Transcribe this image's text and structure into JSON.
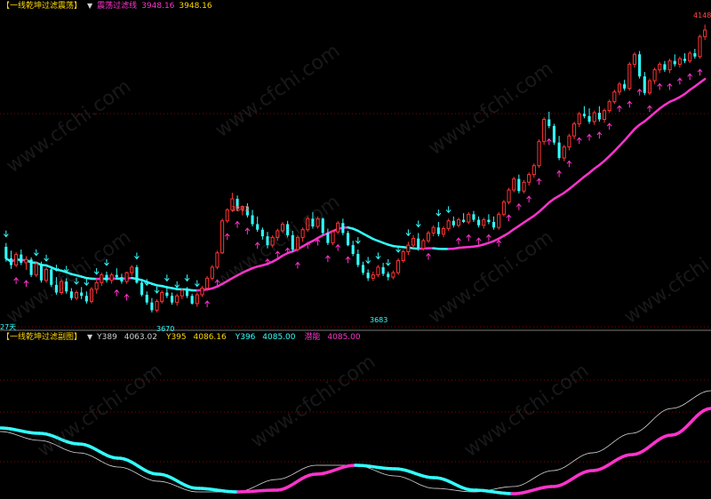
{
  "colors": {
    "background": "#000000",
    "candle_up": "#ff3333",
    "candle_down": "#33ffff",
    "ma_up": "#ff33cc",
    "ma_down": "#33ffff",
    "arrow_up": "#ff33cc",
    "arrow_down": "#33ffff",
    "grid": "#8b0000"
  },
  "main_panel": {
    "indicator_name": "【一线乾坤过滤震荡】",
    "dropdown_icon": "chevron-down-icon",
    "line_label": "震荡过滤线",
    "line_value": "3948.16",
    "extra_value": "3948.16",
    "left_edge_label": "27天",
    "annotations": {
      "high_left": "3843",
      "low_left": "3670",
      "low_mid": "3683",
      "high_right": "4148"
    }
  },
  "sub_panel": {
    "indicator_name": "【一线乾坤过滤副图】",
    "dropdown_icon": "chevron-down-icon",
    "values": [
      {
        "label": "Y389",
        "value": "4063.02"
      },
      {
        "label": "Y395",
        "value": "4086.16"
      },
      {
        "label": "Y396",
        "value": "4085.00"
      },
      {
        "label": "潜能",
        "value": "4085.00"
      }
    ]
  },
  "watermark": "www.cfchi.com",
  "chart_data": {
    "type": "candlestick",
    "ylim": [
      3600,
      4170
    ],
    "candles": [
      [
        3745,
        3752,
        3718,
        3724
      ],
      [
        3724,
        3738,
        3705,
        3712
      ],
      [
        3712,
        3735,
        3708,
        3731
      ],
      [
        3731,
        3740,
        3712,
        3716
      ],
      [
        3716,
        3728,
        3703,
        3722
      ],
      [
        3722,
        3726,
        3690,
        3694
      ],
      [
        3694,
        3718,
        3690,
        3714
      ],
      [
        3714,
        3718,
        3680,
        3684
      ],
      [
        3684,
        3708,
        3680,
        3704
      ],
      [
        3704,
        3708,
        3672,
        3676
      ],
      [
        3676,
        3690,
        3658,
        3662
      ],
      [
        3662,
        3686,
        3658,
        3682
      ],
      [
        3682,
        3688,
        3660,
        3664
      ],
      [
        3664,
        3670,
        3648,
        3652
      ],
      [
        3652,
        3666,
        3648,
        3662
      ],
      [
        3662,
        3672,
        3650,
        3656
      ],
      [
        3656,
        3664,
        3642,
        3646
      ],
      [
        3646,
        3672,
        3642,
        3668
      ],
      [
        3668,
        3684,
        3660,
        3680
      ],
      [
        3680,
        3698,
        3674,
        3694
      ],
      [
        3694,
        3700,
        3680,
        3684
      ],
      [
        3684,
        3698,
        3678,
        3694
      ],
      [
        3694,
        3706,
        3686,
        3690
      ],
      [
        3690,
        3696,
        3678,
        3682
      ],
      [
        3682,
        3700,
        3678,
        3698
      ],
      [
        3698,
        3712,
        3692,
        3708
      ],
      [
        3708,
        3712,
        3678,
        3680
      ],
      [
        3680,
        3684,
        3655,
        3658
      ],
      [
        3658,
        3664,
        3640,
        3644
      ],
      [
        3644,
        3652,
        3626,
        3630
      ],
      [
        3630,
        3650,
        3626,
        3646
      ],
      [
        3646,
        3666,
        3642,
        3662
      ],
      [
        3662,
        3672,
        3652,
        3656
      ],
      [
        3656,
        3662,
        3640,
        3644
      ],
      [
        3644,
        3660,
        3638,
        3656
      ],
      [
        3656,
        3670,
        3650,
        3666
      ],
      [
        3666,
        3672,
        3652,
        3656
      ],
      [
        3656,
        3660,
        3640,
        3642
      ],
      [
        3642,
        3662,
        3636,
        3658
      ],
      [
        3658,
        3674,
        3654,
        3670
      ],
      [
        3670,
        3692,
        3666,
        3688
      ],
      [
        3688,
        3712,
        3684,
        3708
      ],
      [
        3708,
        3738,
        3704,
        3734
      ],
      [
        3734,
        3796,
        3732,
        3792
      ],
      [
        3792,
        3815,
        3788,
        3812
      ],
      [
        3812,
        3843,
        3808,
        3832
      ],
      [
        3832,
        3838,
        3810,
        3814
      ],
      [
        3814,
        3820,
        3802,
        3818
      ],
      [
        3818,
        3824,
        3798,
        3802
      ],
      [
        3802,
        3812,
        3782,
        3786
      ],
      [
        3786,
        3800,
        3772,
        3776
      ],
      [
        3776,
        3780,
        3758,
        3764
      ],
      [
        3764,
        3772,
        3742,
        3748
      ],
      [
        3748,
        3766,
        3744,
        3762
      ],
      [
        3762,
        3778,
        3756,
        3774
      ],
      [
        3774,
        3790,
        3770,
        3786
      ],
      [
        3786,
        3792,
        3762,
        3766
      ],
      [
        3766,
        3774,
        3736,
        3740
      ],
      [
        3740,
        3766,
        3736,
        3762
      ],
      [
        3762,
        3780,
        3754,
        3776
      ],
      [
        3776,
        3800,
        3772,
        3796
      ],
      [
        3796,
        3808,
        3778,
        3782
      ],
      [
        3782,
        3800,
        3778,
        3796
      ],
      [
        3796,
        3798,
        3766,
        3770
      ],
      [
        3770,
        3778,
        3748,
        3752
      ],
      [
        3752,
        3776,
        3748,
        3772
      ],
      [
        3772,
        3792,
        3768,
        3788
      ],
      [
        3788,
        3796,
        3766,
        3770
      ],
      [
        3770,
        3774,
        3746,
        3748
      ],
      [
        3748,
        3756,
        3728,
        3732
      ],
      [
        3732,
        3740,
        3708,
        3712
      ],
      [
        3712,
        3718,
        3694,
        3698
      ],
      [
        3698,
        3704,
        3683,
        3688
      ],
      [
        3688,
        3700,
        3683,
        3694
      ],
      [
        3694,
        3712,
        3690,
        3708
      ],
      [
        3708,
        3716,
        3692,
        3696
      ],
      [
        3696,
        3700,
        3684,
        3690
      ],
      [
        3690,
        3702,
        3686,
        3698
      ],
      [
        3698,
        3724,
        3694,
        3720
      ],
      [
        3720,
        3740,
        3716,
        3736
      ],
      [
        3736,
        3754,
        3730,
        3748
      ],
      [
        3748,
        3766,
        3742,
        3760
      ],
      [
        3760,
        3770,
        3738,
        3742
      ],
      [
        3742,
        3760,
        3738,
        3756
      ],
      [
        3756,
        3774,
        3752,
        3770
      ],
      [
        3770,
        3784,
        3764,
        3780
      ],
      [
        3780,
        3790,
        3764,
        3768
      ],
      [
        3768,
        3782,
        3762,
        3778
      ],
      [
        3778,
        3796,
        3774,
        3792
      ],
      [
        3792,
        3800,
        3780,
        3784
      ],
      [
        3784,
        3798,
        3780,
        3794
      ],
      [
        3794,
        3806,
        3788,
        3790
      ],
      [
        3790,
        3808,
        3786,
        3804
      ],
      [
        3804,
        3810,
        3790,
        3794
      ],
      [
        3794,
        3800,
        3780,
        3784
      ],
      [
        3784,
        3798,
        3778,
        3794
      ],
      [
        3794,
        3804,
        3786,
        3790
      ],
      [
        3790,
        3800,
        3776,
        3780
      ],
      [
        3780,
        3808,
        3776,
        3804
      ],
      [
        3804,
        3830,
        3800,
        3826
      ],
      [
        3826,
        3852,
        3822,
        3848
      ],
      [
        3848,
        3872,
        3844,
        3868
      ],
      [
        3868,
        3876,
        3842,
        3846
      ],
      [
        3846,
        3866,
        3842,
        3862
      ],
      [
        3862,
        3880,
        3856,
        3876
      ],
      [
        3876,
        3896,
        3870,
        3892
      ],
      [
        3892,
        3940,
        3888,
        3936
      ],
      [
        3936,
        3980,
        3930,
        3976
      ],
      [
        3976,
        3990,
        3960,
        3964
      ],
      [
        3964,
        3968,
        3930,
        3934
      ],
      [
        3934,
        3946,
        3902,
        3906
      ],
      [
        3906,
        3930,
        3900,
        3926
      ],
      [
        3926,
        3950,
        3920,
        3946
      ],
      [
        3946,
        3972,
        3940,
        3968
      ],
      [
        3968,
        3990,
        3962,
        3986
      ],
      [
        3986,
        4000,
        3978,
        3982
      ],
      [
        3982,
        3996,
        3968,
        3972
      ],
      [
        3972,
        3992,
        3966,
        3988
      ],
      [
        3988,
        4000,
        3972,
        3976
      ],
      [
        3976,
        3996,
        3970,
        3992
      ],
      [
        3992,
        4012,
        3988,
        4008
      ],
      [
        4008,
        4030,
        4004,
        4026
      ],
      [
        4026,
        4044,
        4020,
        4040
      ],
      [
        4040,
        4048,
        4028,
        4032
      ],
      [
        4032,
        4080,
        4028,
        4076
      ],
      [
        4076,
        4098,
        4070,
        4094
      ],
      [
        4094,
        4100,
        4050,
        4054
      ],
      [
        4054,
        4062,
        4020,
        4024
      ],
      [
        4024,
        4050,
        4020,
        4046
      ],
      [
        4046,
        4070,
        4040,
        4066
      ],
      [
        4066,
        4080,
        4060,
        4076
      ],
      [
        4076,
        4082,
        4062,
        4066
      ],
      [
        4066,
        4086,
        4060,
        4082
      ],
      [
        4082,
        4094,
        4072,
        4076
      ],
      [
        4076,
        4090,
        4070,
        4086
      ],
      [
        4086,
        4096,
        4078,
        4082
      ],
      [
        4082,
        4100,
        4078,
        4096
      ],
      [
        4096,
        4104,
        4086,
        4090
      ],
      [
        4090,
        4130,
        4086,
        4126
      ],
      [
        4126,
        4148,
        4120,
        4138
      ]
    ]
  }
}
